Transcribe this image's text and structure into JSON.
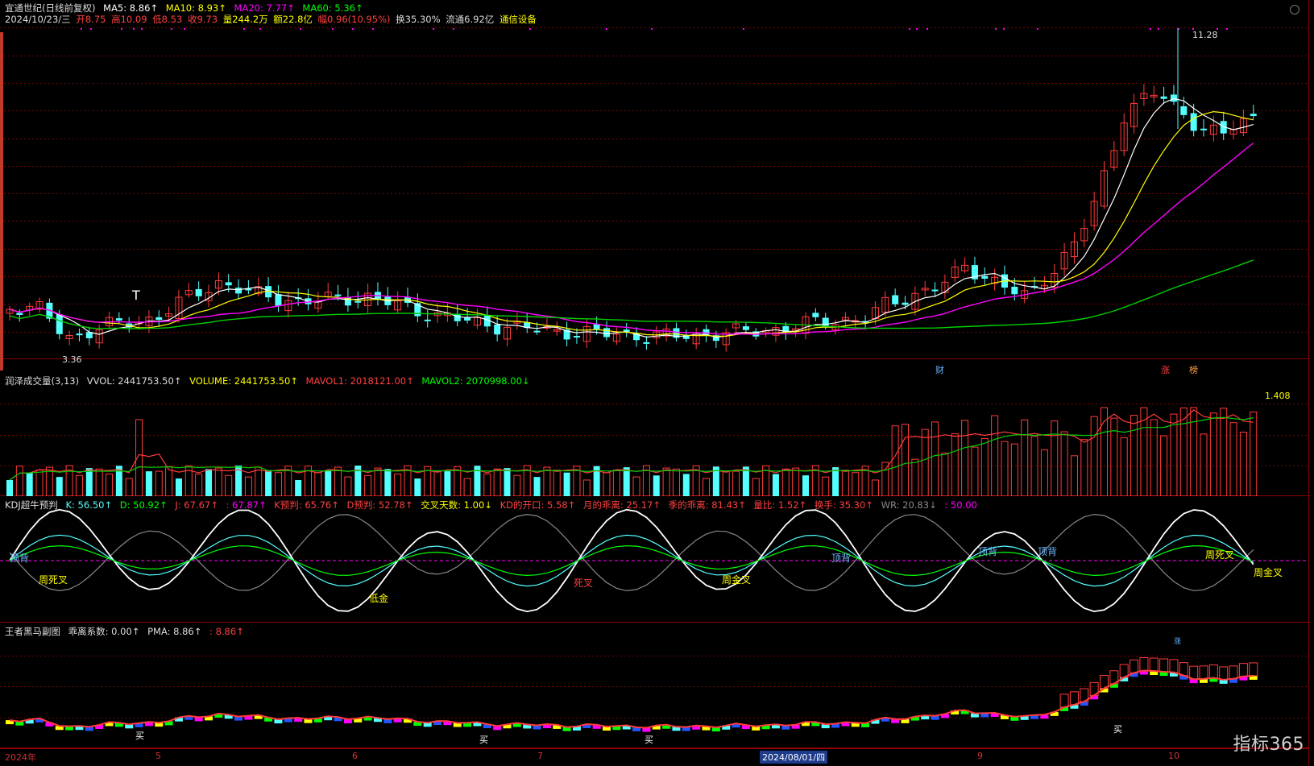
{
  "main_header": {
    "title": "宜通世纪(日线前复权)",
    "ma5": "MA5: 8.86↑",
    "ma10": "MA10: 8.93↑",
    "ma20": "MA20: 7.77↑",
    "ma60": "MA60: 5.36↑"
  },
  "quote_line": {
    "date": "2024/10/23/三",
    "open": "开8.75",
    "high": "高10.09",
    "low": "低8.53",
    "close": "收9.73",
    "volume": "量244.2万",
    "amount": "额22.8亿",
    "change": "幅0.96(10.95%)",
    "turnover": "换35.30%",
    "float": "流通6.92亿",
    "sector": "通信设备"
  },
  "price_labels": {
    "high": "11.28",
    "low": "3.36",
    "t_marker": "T",
    "cai": "财",
    "zhang": "涨",
    "bang": "榜"
  },
  "vol_header": {
    "name": "润泽成交量(3,13)",
    "vvol": "VVOL: 2441753.50↑",
    "volume": "VOLUME: 2441753.50↑",
    "mavol1": "MAVOL1: 2018121.00↑",
    "mavol2": "MAVOL2: 2070998.00↓"
  },
  "vol_max_label": "1.408",
  "kdj_header": {
    "name": "KDJ超牛预判",
    "k": "K: 56.50↑",
    "d": "D: 50.92↑",
    "j": "J: 67.67↑",
    "j2": ": 67.87↑",
    "kp": "K预判: 65.76↑",
    "dp": "D预判: 52.78↑",
    "days": "交叉天数: 1.00↓",
    "open": "KD的开口: 5.58↑",
    "month": "月的乖离: 25.17↑",
    "season": "季的乖离: 81.43↑",
    "ratio": "量比: 1.52↑",
    "turn": "换手: 35.30↑",
    "wr": "WR: 20.83↓",
    "v50": ": 50.00"
  },
  "kdj_labels": [
    "顶背",
    "周死叉",
    "低金",
    "死叉",
    "周金叉",
    "顶背",
    "顶背",
    "顶背",
    "周死叉",
    "周金叉"
  ],
  "bottom_header": {
    "name": "王者黑马副图",
    "coef": "乖离系数: 0.00↑",
    "pma": "PMA: 8.86↑",
    "pma2": ": 8.86↑"
  },
  "bottom_labels": {
    "buy": "买",
    "tag": "涨"
  },
  "axis": {
    "year": "2024年",
    "m5": "5",
    "m6": "6",
    "m7": "7",
    "selected_date": "2024/08/01/四",
    "m9": "9",
    "m10": "10"
  },
  "watermark": "指标365",
  "right_edge_mark": "5",
  "colors": {
    "up": "#ff3b3b",
    "down": "#54ffff",
    "ma5": "#ffffff",
    "ma10": "#ffff00",
    "ma20": "#ff00ff",
    "ma60": "#00d000",
    "grid": "#7a0000"
  }
}
